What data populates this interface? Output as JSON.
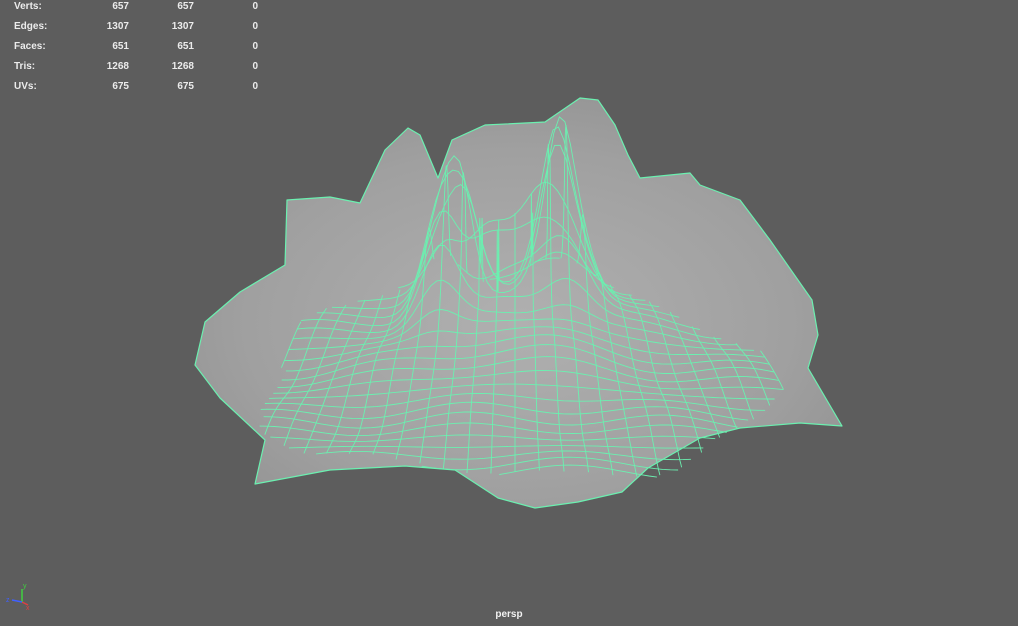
{
  "viewport": {
    "camera": "persp",
    "background_color": "#5d5d5d",
    "wireframe_color": "#6bf0b0",
    "surface_color": "#a3a3a3"
  },
  "hud": {
    "rows": [
      {
        "label": "Verts:",
        "v1": "657",
        "v2": "657",
        "v3": "0"
      },
      {
        "label": "Edges:",
        "v1": "1307",
        "v2": "1307",
        "v3": "0"
      },
      {
        "label": "Faces:",
        "v1": "651",
        "v2": "651",
        "v3": "0"
      },
      {
        "label": "Tris:",
        "v1": "1268",
        "v2": "1268",
        "v3": "0"
      },
      {
        "label": "UVs:",
        "v1": "675",
        "v2": "675",
        "v3": "0"
      }
    ]
  },
  "axis_gizmo": {
    "x_label": "x",
    "y_label": "y",
    "z_label": "z",
    "x_color": "#e04040",
    "y_color": "#40d040",
    "z_color": "#4060ff"
  }
}
